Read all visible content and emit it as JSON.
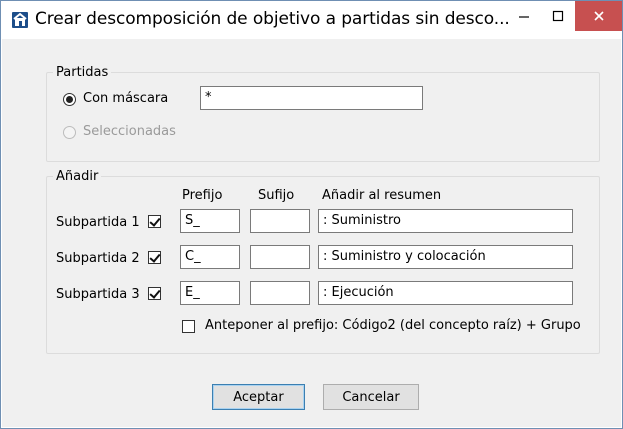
{
  "window": {
    "title": "Crear descomposición de objetivo a partidas sin desco...",
    "minimize": "–",
    "maximize": "□",
    "close": "×"
  },
  "partidas": {
    "legend": "Partidas",
    "con_mascara_label": "Con máscara",
    "con_mascara_checked": true,
    "mask_value": "*",
    "seleccionadas_label": "Seleccionadas",
    "seleccionadas_enabled": false
  },
  "anadir": {
    "legend": "Añadir",
    "headers": {
      "prefijo": "Prefijo",
      "sufijo": "Sufijo",
      "resumen": "Añadir al resumen"
    },
    "rows": [
      {
        "label": "Subpartida 1",
        "checked": true,
        "prefijo": "S_",
        "sufijo": "",
        "resumen": ": Suministro"
      },
      {
        "label": "Subpartida 2",
        "checked": true,
        "prefijo": "C_",
        "sufijo": "",
        "resumen": ": Suministro y colocación"
      },
      {
        "label": "Subpartida 3",
        "checked": true,
        "prefijo": "E_",
        "sufijo": "",
        "resumen": ": Ejecución"
      }
    ],
    "anteponer_label": "Anteponer al prefijo: Código2 (del concepto raíz) + Grupo",
    "anteponer_checked": false
  },
  "buttons": {
    "aceptar": "Aceptar",
    "cancelar": "Cancelar"
  },
  "colors": {
    "close_button": "#c75050",
    "window_border": "#6f8fb3",
    "dialog_bg": "#f0f0f0"
  }
}
